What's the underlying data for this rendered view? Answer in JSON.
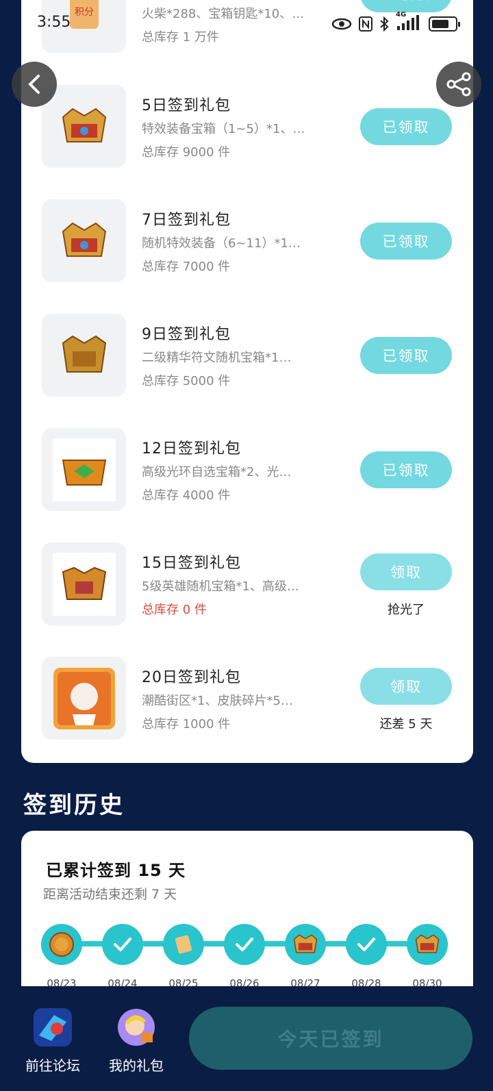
{
  "status_bar": {
    "time": "3:55",
    "network": "4G"
  },
  "gifts": [
    {
      "title": "",
      "desc": "火柴*288、宝箱钥匙*10、…",
      "stock": "总库存 1 万件",
      "button": "已领取",
      "note": ""
    },
    {
      "title": "5日签到礼包",
      "desc": "特效装备宝箱（1~5）*1、…",
      "stock": "总库存 9000 件",
      "button": "已领取",
      "note": ""
    },
    {
      "title": "7日签到礼包",
      "desc": "随机特效装备（6~11）*1…",
      "stock": "总库存 7000 件",
      "button": "已领取",
      "note": ""
    },
    {
      "title": "9日签到礼包",
      "desc": "二级精华符文随机宝箱*1…",
      "stock": "总库存 5000 件",
      "button": "已领取",
      "note": ""
    },
    {
      "title": "12日签到礼包",
      "desc": "高级光环自选宝箱*2、光…",
      "stock": "总库存 4000 件",
      "button": "已领取",
      "note": ""
    },
    {
      "title": "15日签到礼包",
      "desc": "5级英雄随机宝箱*1、高级…",
      "stock": "总库存 0 件",
      "button": "领取",
      "note": "抢光了"
    },
    {
      "title": "20日签到礼包",
      "desc": "潮酷街区*1、皮肤碎片*5…",
      "stock": "总库存 1000 件",
      "button": "领取",
      "note": "还差 5 天"
    }
  ],
  "history": {
    "section_title": "签到历史",
    "total": "已累计签到 15 天",
    "remaining": "距离活动结束还剩 7 天",
    "days": [
      "08/23",
      "08/24",
      "08/25",
      "08/26",
      "08/27",
      "08/28",
      "08/30"
    ]
  },
  "bottom": {
    "forum_label": "前往论坛",
    "gifts_label": "我的礼包",
    "signed_label": "今天已签到"
  },
  "colors": {
    "background": "#0a1d45",
    "button": "#74d8e0",
    "timeline": "#29c4cc",
    "stock_empty": "#e0493e"
  }
}
